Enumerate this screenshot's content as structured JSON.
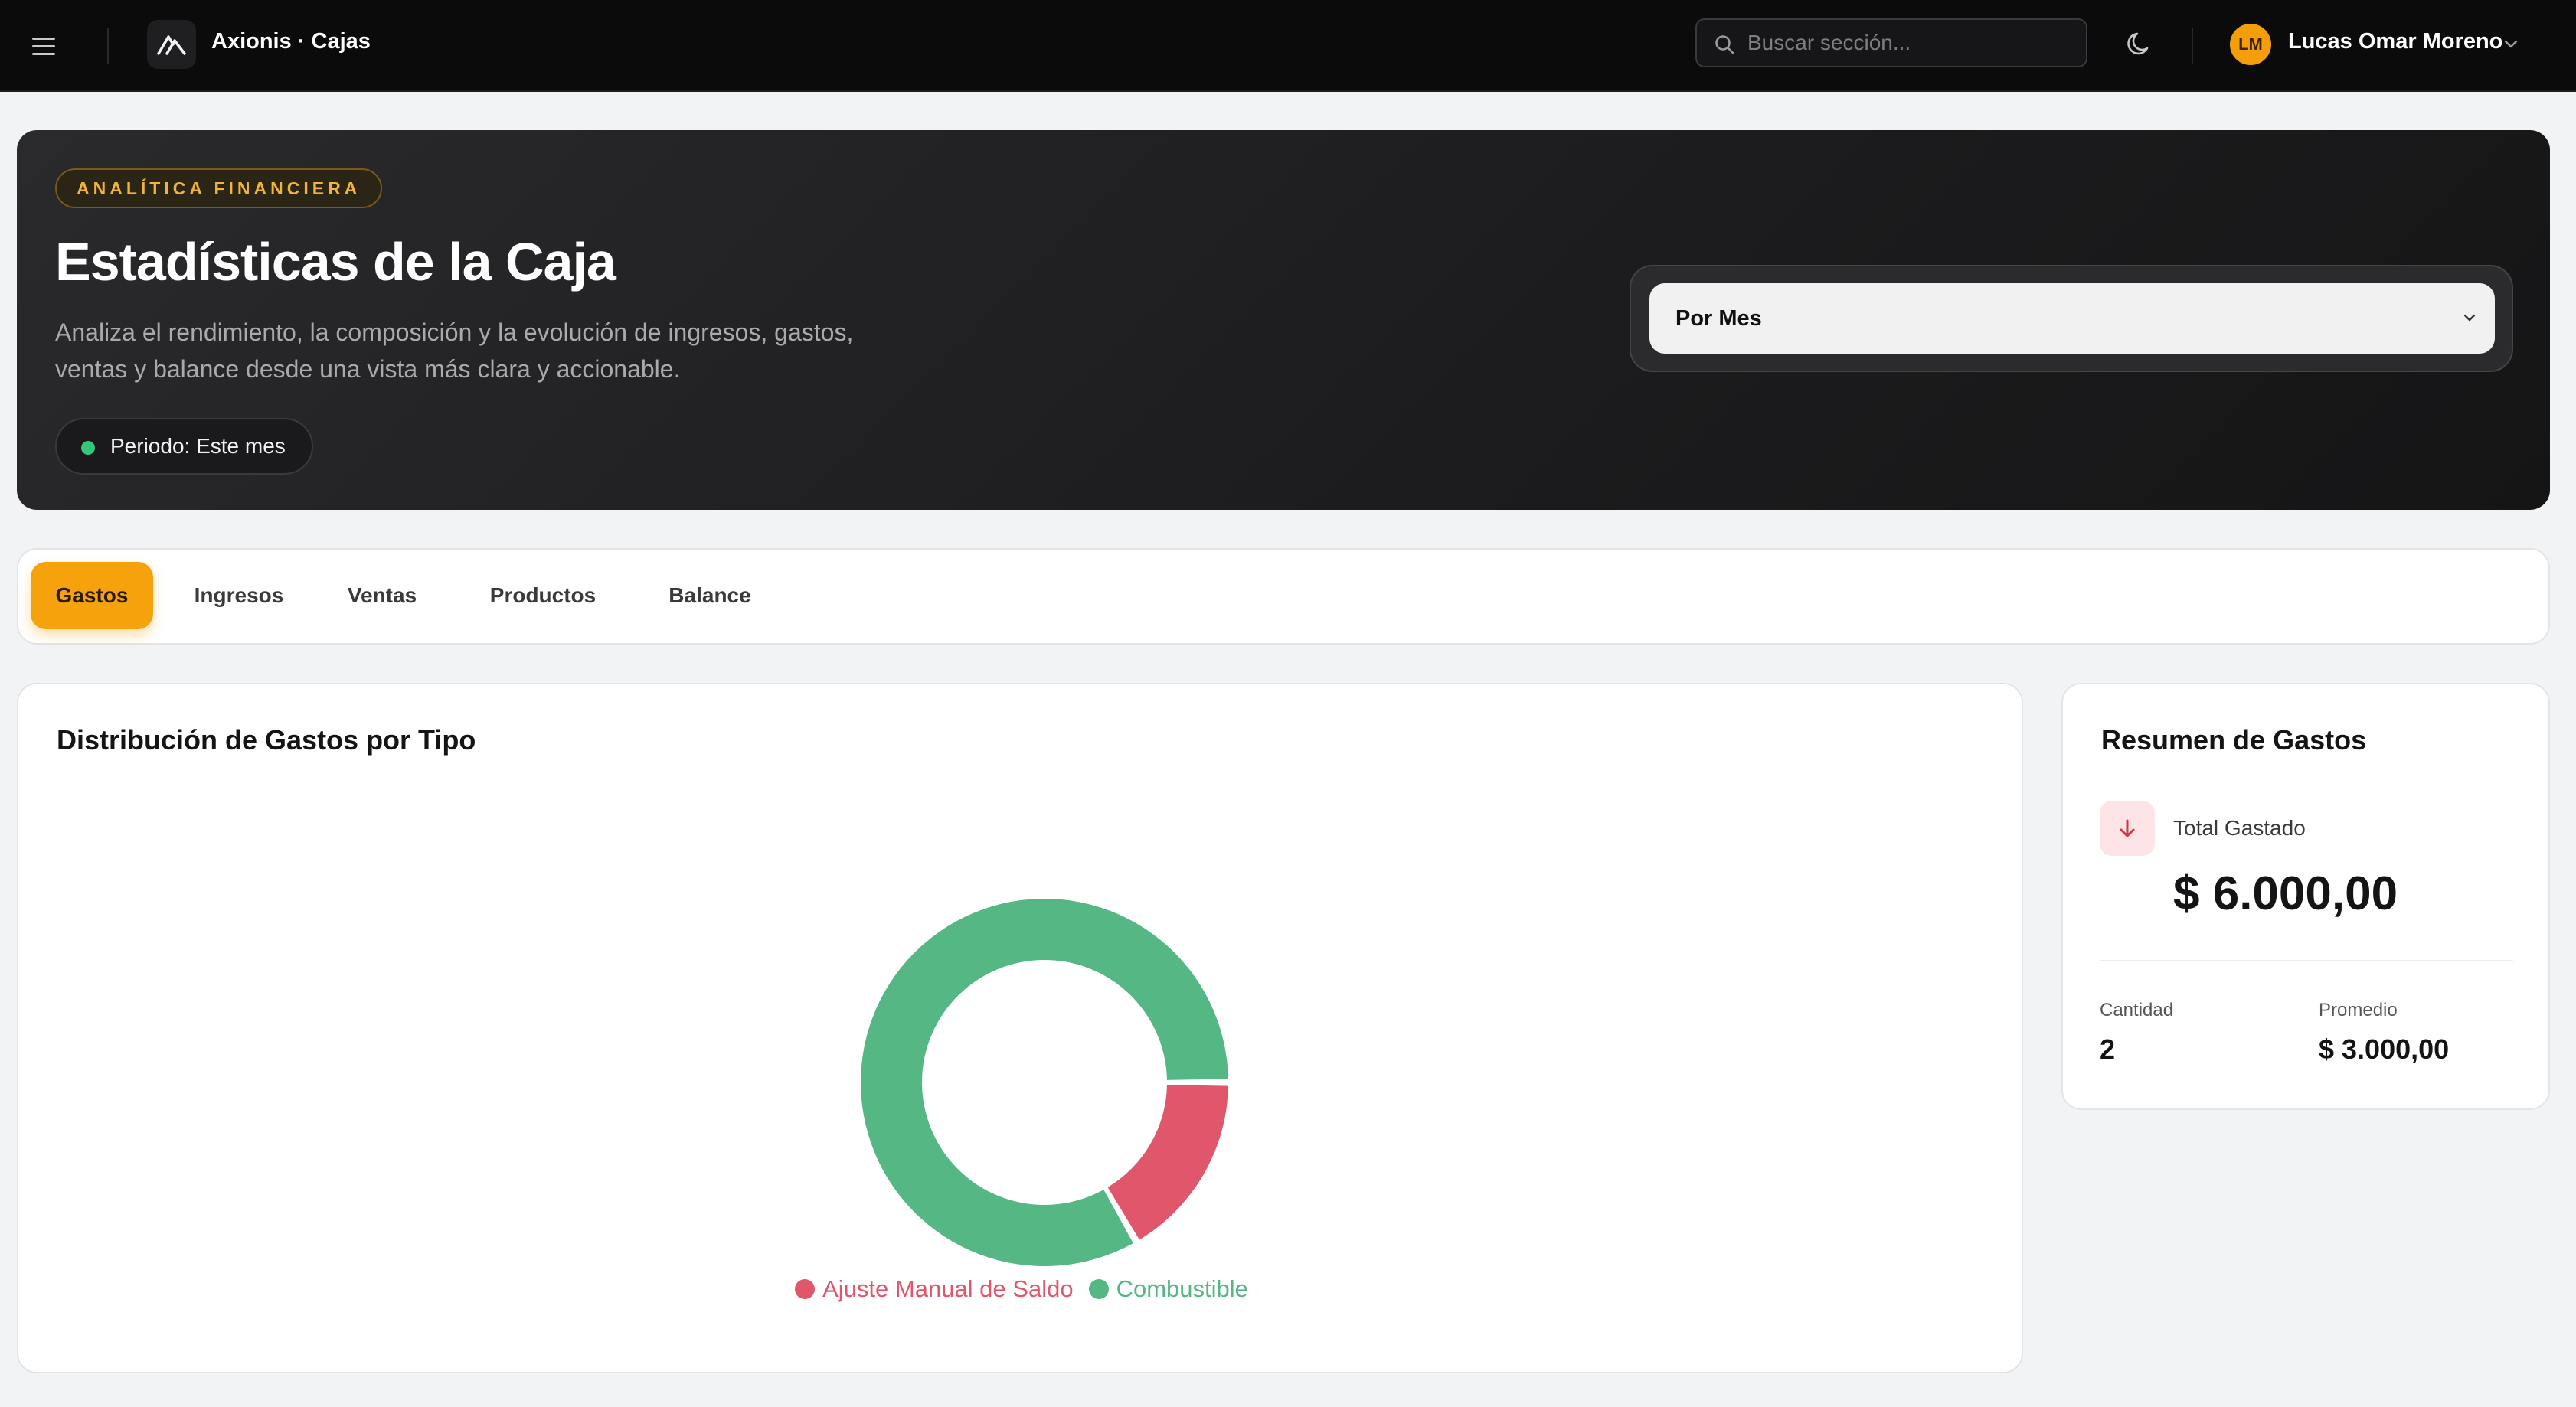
{
  "topbar": {
    "brand": "Axionis · Cajas",
    "search_placeholder": "Buscar sección...",
    "user_initials": "LM",
    "user_name": "Lucas Omar Moreno"
  },
  "hero": {
    "tag": "ANALÍTICA FINANCIERA",
    "title": "Estadísticas de la Caja",
    "description": "Analiza el rendimiento, la composición y la evolución de ingresos, gastos, ventas y balance desde una vista más clara y accionable.",
    "period": "Periodo: Este mes",
    "select_value": "Por Mes"
  },
  "tabs": [
    {
      "label": "Gastos",
      "active": true
    },
    {
      "label": "Ingresos",
      "active": false
    },
    {
      "label": "Ventas",
      "active": false
    },
    {
      "label": "Productos",
      "active": false
    },
    {
      "label": "Balance",
      "active": false
    }
  ],
  "chart_card": {
    "title": "Distribución de Gastos por Tipo"
  },
  "chart_data": {
    "type": "pie",
    "donut": true,
    "categories": [
      "Ajuste Manual de Saldo",
      "Combustible"
    ],
    "values": [
      1000,
      5000
    ],
    "colors": [
      "#e0566a",
      "#55b784"
    ],
    "legend_position": "bottom"
  },
  "summary": {
    "title": "Resumen de Gastos",
    "total_label": "Total Gastado",
    "total_value": "$ 6.000,00",
    "count_label": "Cantidad",
    "count_value": "2",
    "avg_label": "Promedio",
    "avg_value": "$ 3.000,00"
  },
  "colors": {
    "accent": "#f5a20d",
    "expense_red": "#e0566a",
    "fuel_green": "#55b784"
  },
  "icons": [
    "menu-icon",
    "logo-icon",
    "search-icon",
    "moon-icon",
    "chevron-down-icon",
    "arrow-down-icon"
  ]
}
